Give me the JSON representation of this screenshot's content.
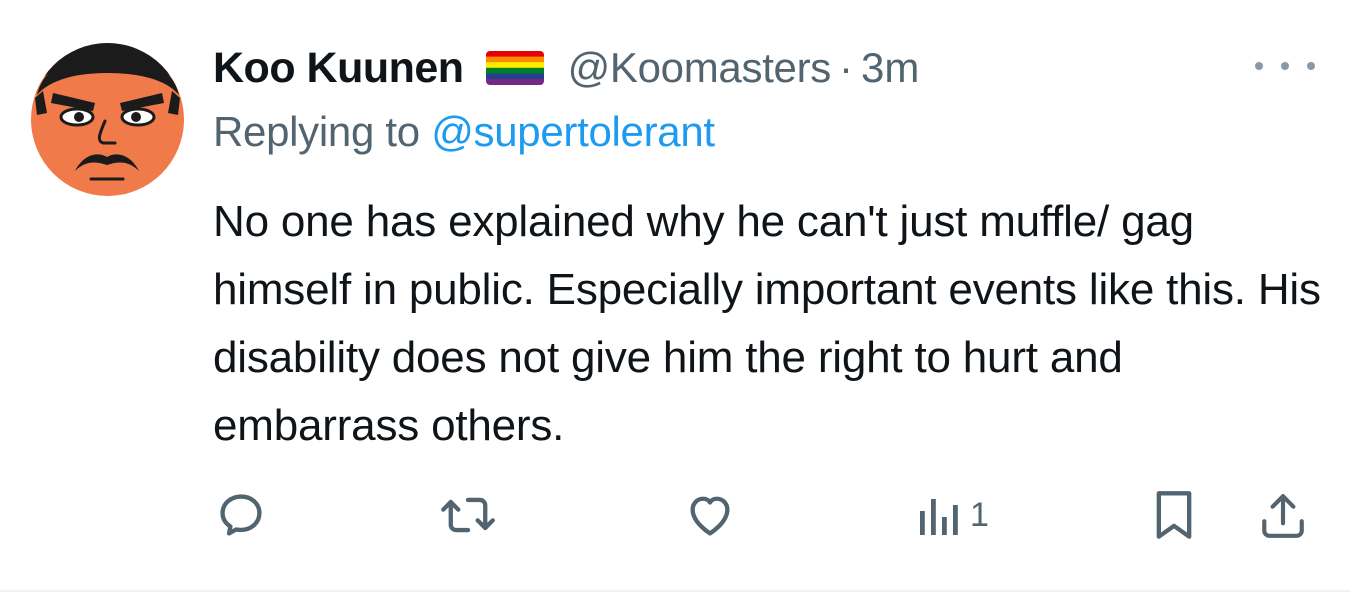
{
  "author": {
    "display_name": "Koo Kuunen",
    "badge_icon": "rainbow-flag-icon",
    "handle": "@Koomasters",
    "separator": "·",
    "timestamp": "3m"
  },
  "reply": {
    "prefix": "Replying to",
    "target": "@supertolerant"
  },
  "tweet_text": "No one has explained why he can't just muffle/ gag himself in public. Especially important events like this. His disability does not give him the right to hurt and embarrass others.",
  "actions": {
    "reply_icon": "comment-icon",
    "retweet_icon": "retweet-icon",
    "like_icon": "heart-icon",
    "views_icon": "analytics-icon",
    "views_count": "1",
    "bookmark_icon": "bookmark-icon",
    "share_icon": "share-icon"
  },
  "colors": {
    "text": "#0f1419",
    "secondary": "#536471",
    "link": "#1d9bf0",
    "avatar_bg": "#f07a4a"
  }
}
